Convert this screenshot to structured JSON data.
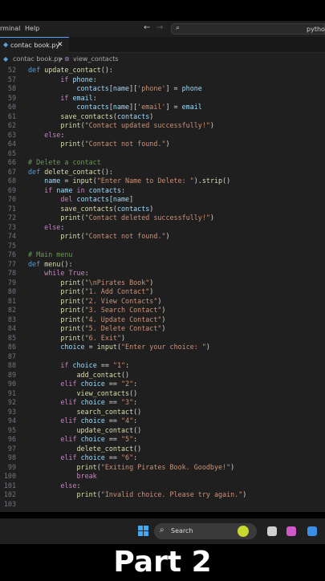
{
  "menubar": {
    "terminal": "rminal",
    "help": "Help"
  },
  "command_center": {
    "text": "python"
  },
  "tab": {
    "filename": "contac book.py",
    "close": "✕"
  },
  "breadcrumb": {
    "file": "contac book.py",
    "separator": ">",
    "symbol": "view_contacts"
  },
  "code_lines": [
    {
      "n": "52",
      "t": "def update_contact():"
    },
    {
      "n": "57",
      "t": "        if phone:"
    },
    {
      "n": "58",
      "t": "            contacts[name]['phone'] = phone"
    },
    {
      "n": "59",
      "t": "        if email:"
    },
    {
      "n": "60",
      "t": "            contacts[name]['email'] = email"
    },
    {
      "n": "61",
      "t": "        save_contacts(contacts)"
    },
    {
      "n": "62",
      "t": "        print(\"Contact updated successfully!\")"
    },
    {
      "n": "63",
      "t": "    else:"
    },
    {
      "n": "64",
      "t": "        print(\"Contact not found.\")"
    },
    {
      "n": "65",
      "t": ""
    },
    {
      "n": "66",
      "t": "# Delete a contact"
    },
    {
      "n": "67",
      "t": "def delete_contact():"
    },
    {
      "n": "68",
      "t": "    name = input(\"Enter Name to Delete: \").strip()"
    },
    {
      "n": "69",
      "t": "    if name in contacts:"
    },
    {
      "n": "70",
      "t": "        del contacts[name]"
    },
    {
      "n": "71",
      "t": "        save_contacts(contacts)"
    },
    {
      "n": "72",
      "t": "        print(\"Contact deleted successfully!\")"
    },
    {
      "n": "73",
      "t": "    else:"
    },
    {
      "n": "74",
      "t": "        print(\"Contact not found.\")"
    },
    {
      "n": "75",
      "t": ""
    },
    {
      "n": "76",
      "t": "# Main menu"
    },
    {
      "n": "77",
      "t": "def menu():"
    },
    {
      "n": "78",
      "t": "    while True:"
    },
    {
      "n": "79",
      "t": "        print(\"\\nPirates Book\")"
    },
    {
      "n": "80",
      "t": "        print(\"1. Add Contact\")"
    },
    {
      "n": "81",
      "t": "        print(\"2. View Contacts\")"
    },
    {
      "n": "82",
      "t": "        print(\"3. Search Contact\")"
    },
    {
      "n": "83",
      "t": "        print(\"4. Update Contact\")"
    },
    {
      "n": "84",
      "t": "        print(\"5. Delete Contact\")"
    },
    {
      "n": "85",
      "t": "        print(\"6. Exit\")"
    },
    {
      "n": "86",
      "t": "        choice = input(\"Enter your choice: \")"
    },
    {
      "n": "87",
      "t": ""
    },
    {
      "n": "88",
      "t": "        if choice == \"1\":"
    },
    {
      "n": "89",
      "t": "            add_contact()"
    },
    {
      "n": "90",
      "t": "        elif choice == \"2\":"
    },
    {
      "n": "91",
      "t": "            view_contacts()"
    },
    {
      "n": "92",
      "t": "        elif choice == \"3\":"
    },
    {
      "n": "93",
      "t": "            search_contact()"
    },
    {
      "n": "94",
      "t": "        elif choice == \"4\":"
    },
    {
      "n": "95",
      "t": "            update_contact()"
    },
    {
      "n": "96",
      "t": "        elif choice == \"5\":"
    },
    {
      "n": "97",
      "t": "            delete_contact()"
    },
    {
      "n": "98",
      "t": "        elif choice == \"6\":"
    },
    {
      "n": "99",
      "t": "            print(\"Exiting Pirates Book. Goodbye!\")"
    },
    {
      "n": "100",
      "t": "            break"
    },
    {
      "n": "101",
      "t": "        else:"
    },
    {
      "n": "102",
      "t": "            print(\"Invalid choice. Please try again.\")"
    },
    {
      "n": "103",
      "t": ""
    }
  ],
  "taskbar": {
    "search_label": "Search",
    "start_icon": "windows-logo-icon",
    "search_icon": "magnifier-icon"
  },
  "caption": "Part 2",
  "colors": {
    "keyword": "#c586c0",
    "def": "#569cd6",
    "function": "#dcdcaa",
    "string": "#ce9178",
    "variable": "#9cdcfe",
    "comment": "#6a9955",
    "accent": "#4fa3ff"
  }
}
